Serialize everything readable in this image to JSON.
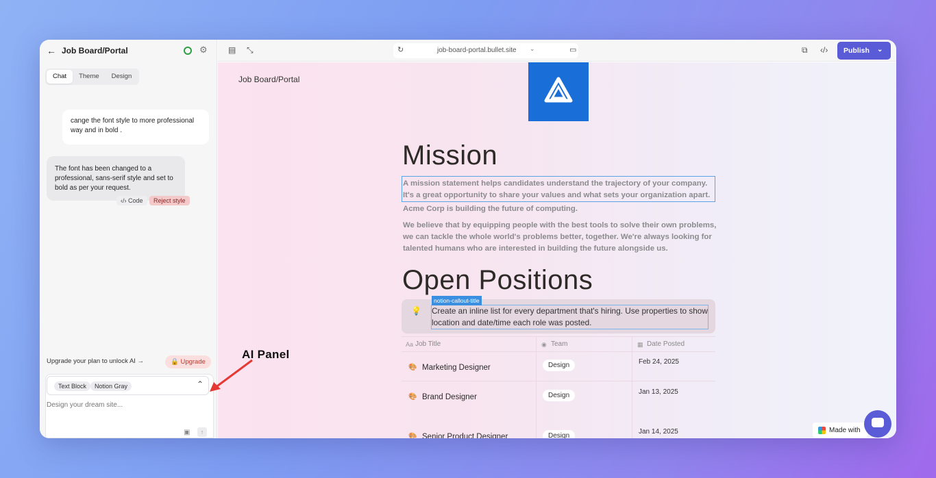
{
  "left_panel": {
    "project_title": "Job Board/Portal",
    "tabs": [
      {
        "label": "Chat",
        "active": true
      },
      {
        "label": "Theme",
        "active": false
      },
      {
        "label": "Design",
        "active": false
      }
    ],
    "user_message": "cange the font style to more professional way and in bold .",
    "ai_message": "The font has been changed to a professional, sans-serif style and set to bold as per your request.",
    "code_label": "Code",
    "reject_label": "Reject style",
    "upgrade_text": "Upgrade your plan to unlock AI",
    "upgrade_button": "Upgrade",
    "selector_pills": [
      "Text Block",
      "Notion Gray"
    ],
    "prompt_placeholder": "Design your dream site..."
  },
  "toolbar": {
    "url": "job-board-portal.bullet.site",
    "publish_label": "Publish",
    "accent_color": "#5a5bd6"
  },
  "preview": {
    "brand": "Job Board/Portal",
    "mission_heading": "Mission",
    "mission_highlight": "A mission statement helps candidates understand the trajectory of your company. It's a great opportunity to share your values and what sets your organization apart.",
    "paragraph_1": "Acme Corp is building the future of computing.",
    "paragraph_2": "We believe that by equipping people with the best tools to solve their own problems, we can tackle the whole world's problems better, together. We're always looking for talented humans who are interested in building the future alongside us.",
    "positions_heading": "Open Positions",
    "callout_tag": "notion-callout-title",
    "callout_text": "Create an inline list for every department that's hiring. Use properties to show location and date/time each role was posted.",
    "table": {
      "headers": [
        "Job Title",
        "Team",
        "Date Posted"
      ],
      "rows": [
        {
          "title": "Marketing Designer",
          "team": "Design",
          "date": "Feb 24, 2025"
        },
        {
          "title": "Brand Designer",
          "team": "Design",
          "date": "Jan 13, 2025"
        },
        {
          "title": "Senior Product Designer",
          "team": "Design",
          "date": "Jan 14, 2025"
        }
      ]
    },
    "made_with": "Made with"
  },
  "annotation": {
    "label": "AI Panel",
    "color": "#e53935"
  }
}
